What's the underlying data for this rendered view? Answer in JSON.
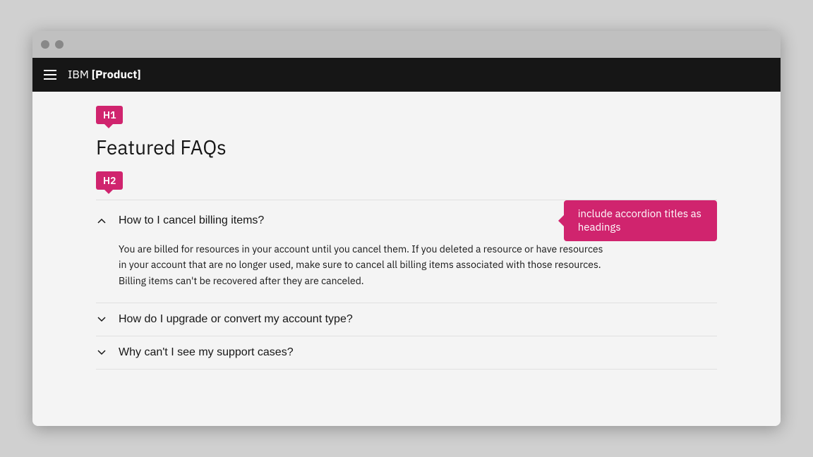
{
  "browser": {
    "dots": [
      "dot1",
      "dot2"
    ]
  },
  "nav": {
    "title_regular": "IBM ",
    "title_bold": "[Product]",
    "hamburger_label": "menu"
  },
  "page": {
    "h1_badge": "H1",
    "h1_text": "Featured FAQs",
    "h2_badge": "H2",
    "tooltip_text": "include accordion titles as headings",
    "accordion_items": [
      {
        "id": "item1",
        "title": "How to I cancel billing items?",
        "expanded": true,
        "content": "You are billed for resources in your account until you cancel them. If you deleted a resource or have resources in your account that are no longer used, make sure to cancel all billing items associated with those resources. Billing items can't be recovered after they are canceled."
      },
      {
        "id": "item2",
        "title": "How do I upgrade or convert my account type?",
        "expanded": false,
        "content": ""
      },
      {
        "id": "item3",
        "title": "Why can't I see my support cases?",
        "expanded": false,
        "content": ""
      }
    ]
  },
  "icons": {
    "chevron_up": "∧",
    "chevron_down": "∨"
  }
}
